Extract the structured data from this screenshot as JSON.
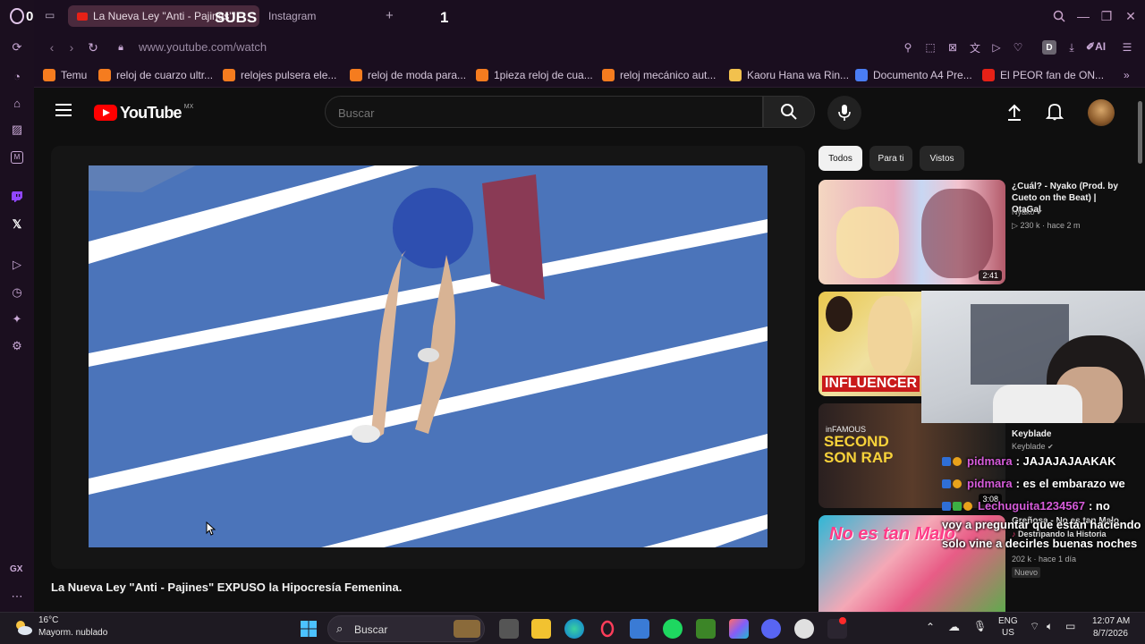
{
  "overlay": {
    "subs_label": "SUBS",
    "subs_count": "1"
  },
  "browser": {
    "speed_dial_count": "0",
    "tabs": [
      {
        "label": "La Nueva Ley \"Anti - Pajines\"",
        "active": true
      },
      {
        "label": "Instagram",
        "active": false
      }
    ],
    "new_tab_label": "+",
    "url": "www.youtube.com/watch",
    "ai_label": "AI",
    "profile_letter": "D",
    "bookmarks": [
      {
        "label": "Temu",
        "color": "#f57c1f"
      },
      {
        "label": "reloj de cuarzo ultr...",
        "color": "#f57c1f"
      },
      {
        "label": "relojes pulsera ele...",
        "color": "#f57c1f"
      },
      {
        "label": "reloj de moda para...",
        "color": "#f57c1f"
      },
      {
        "label": "1pieza reloj de cua...",
        "color": "#f57c1f"
      },
      {
        "label": "reloj mecánico aut...",
        "color": "#f57c1f"
      },
      {
        "label": "Kaoru Hana wa Rin...",
        "color": "#f2c14e"
      },
      {
        "label": "Documento A4 Pre...",
        "color": "#4a7df3"
      },
      {
        "label": "El PEOR fan de ON...",
        "color": "#e62117"
      }
    ],
    "sidebar_bottom_label": "GX"
  },
  "youtube": {
    "logo_text": "YouTube",
    "region": "MX",
    "search_placeholder": "Buscar",
    "video_title": "La Nueva Ley \"Anti - Pajines\" EXPUSO la Hipocresía Femenina.",
    "chips": [
      "Todos",
      "Para ti",
      "Vistos"
    ],
    "recommendations": [
      {
        "title": "¿Cuál? - Nyako (Prod. by Cueto on the Beat) | OtaGal",
        "channel": "Nyako",
        "meta": "230 k  ·  hace 2 m",
        "duration": "2:41"
      },
      {
        "title": "",
        "channel": "",
        "meta": "",
        "duration": ""
      },
      {
        "title": "Keyblade",
        "channel": "Keyblade",
        "meta": "",
        "duration": "3:08"
      },
      {
        "title": "Destripando la Historia",
        "channel": "",
        "meta": "202 k  ·  hace 1 día",
        "duration": ""
      }
    ],
    "thumb_texts": {
      "influencer": "INFLUENCER",
      "second_son": "SECOND SON RAP",
      "infamous": "inFAMOUS",
      "no_es_tan_malo": "No es tan Malo"
    },
    "badge_nuevo": "Nuevo",
    "no_es_tan_malo_title": "Greñosa - No es tan Malo"
  },
  "chat": {
    "messages": [
      {
        "user": "pidmara",
        "text": ": JAJAJAJAAKAK"
      },
      {
        "user": "pidmara",
        "text": ": es el embarazo we"
      },
      {
        "user": "Lechuguita1234567",
        "text": ": no"
      }
    ],
    "plain_message": "voy a preguntar que están haciendo solo vine a decirles buenas noches"
  },
  "taskbar": {
    "weather_temp": "16°C",
    "weather_desc": "Mayorm. nublado",
    "search_placeholder": "Buscar",
    "language": "ENG",
    "region": "US",
    "time": "12:07 AM",
    "date": "8/7/2026"
  }
}
